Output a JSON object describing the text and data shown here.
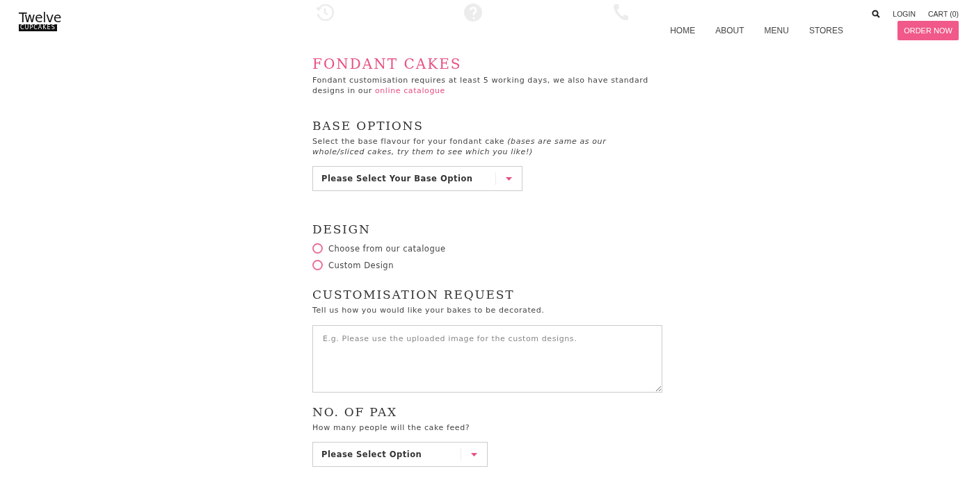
{
  "logo": {
    "top": "Twelve",
    "bottom": "CUPCAKES"
  },
  "utility_nav": [
    {
      "label": "LOGIN"
    },
    {
      "label": "CART (0)"
    }
  ],
  "main_nav": [
    {
      "label": "HOME"
    },
    {
      "label": "ABOUT"
    },
    {
      "label": "MENU"
    },
    {
      "label": "STORES"
    }
  ],
  "order_button": "ORDER NOW",
  "steps": [
    {
      "kind": "clock"
    },
    {
      "kind": "question"
    },
    {
      "kind": "phone"
    }
  ],
  "title": "FONDANT CAKES",
  "intro": {
    "text": "Fondant customisation requires at least 5 working days, we also have standard designs in our ",
    "link": "online catalogue"
  },
  "base_options": {
    "heading": "BASE OPTIONS",
    "description": "Select the base flavour for your fondant cake *(bases are same as our whole/sliced cakes, try them to see which you like!)*",
    "select": "Please Select Your Base Option"
  },
  "design": {
    "heading": "DESIGN",
    "options": [
      {
        "label": "Choose from our catalogue",
        "selected": false
      },
      {
        "label": "Custom Design",
        "selected": false
      }
    ]
  },
  "customisation": {
    "heading": "CUSTOMISATION REQUEST",
    "description": "Tell us how you would like your bakes to be decorated.",
    "placeholder": "E.g. Please use the uploaded image for the custom designs."
  },
  "pax": {
    "heading": "NO. OF PAX",
    "description": "How many people will the cake feed?",
    "select": "Please Select Option"
  }
}
